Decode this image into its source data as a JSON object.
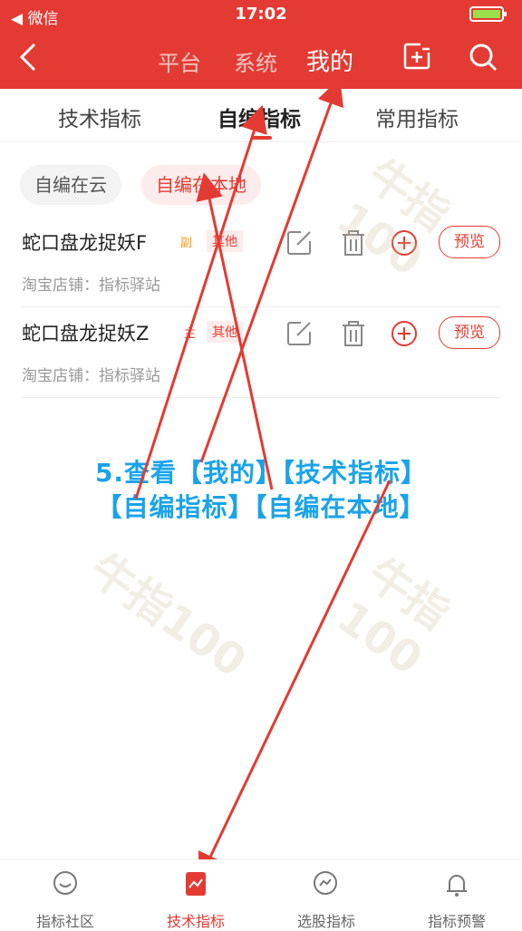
{
  "status_bar": {
    "carrier": "◀ 微信",
    "time": "17:02"
  },
  "nav": {
    "tabs": [
      "平台",
      "系统",
      "我的"
    ],
    "active_index": 2
  },
  "sub_tabs": {
    "items": [
      "技术指标",
      "自编指标",
      "常用指标"
    ],
    "active_index": 1
  },
  "filter_chips": {
    "items": [
      "自编在云",
      "自编在本地"
    ],
    "active_index": 1
  },
  "indicators": [
    {
      "name": "蛇口盘龙捉妖F",
      "tag": "副",
      "category": "其他",
      "shop": "淘宝店铺：指标驿站",
      "preview_label": "预览"
    },
    {
      "name": "蛇口盘龙捉妖Z",
      "tag": "主",
      "category": "其他",
      "shop": "淘宝店铺：指标驿站",
      "preview_label": "预览"
    }
  ],
  "overlay": {
    "line1": "5.查看【我的】【技术指标】",
    "line2": "【自编指标】【自编在本地】"
  },
  "watermark_text": "牛指100",
  "bottom_nav": {
    "items": [
      "指标社区",
      "技术指标",
      "选股指标",
      "指标预警"
    ],
    "active_index": 1
  },
  "colors": {
    "brand": "#e33b33",
    "overlay_text": "#1aa3ea",
    "tag_fu": "#f0a020"
  }
}
